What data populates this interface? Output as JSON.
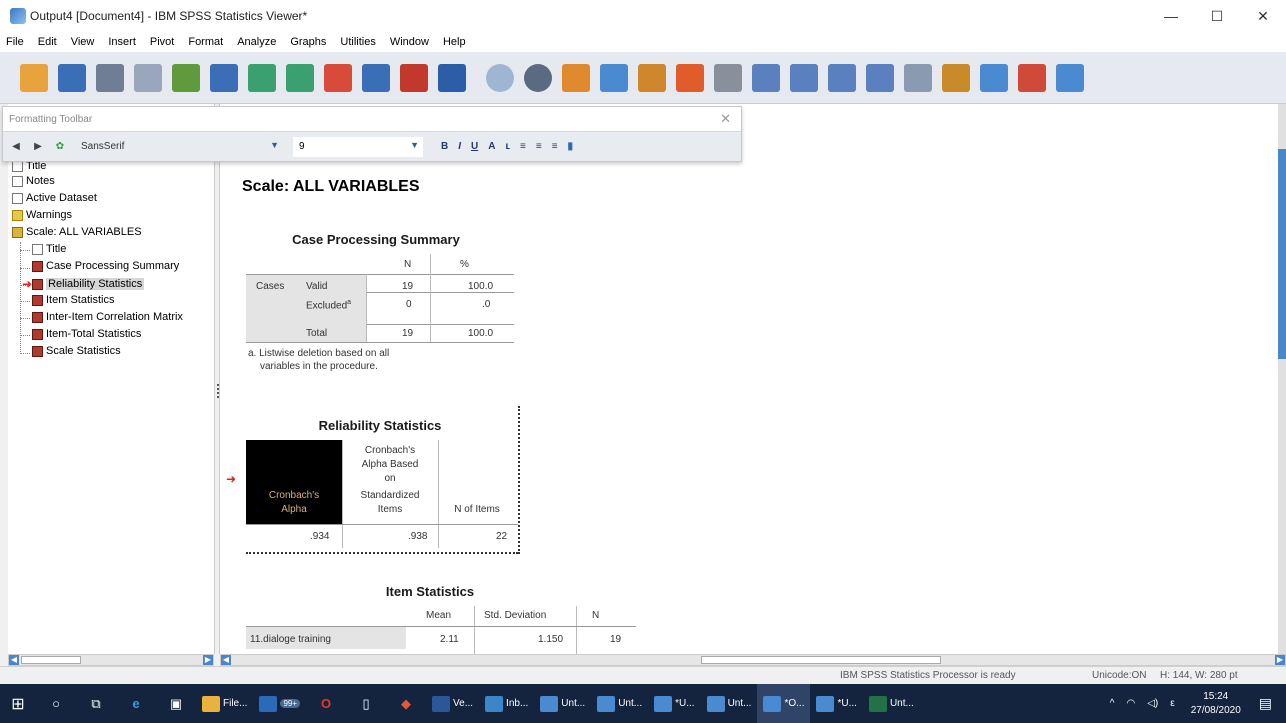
{
  "window": {
    "title": "Output4 [Document4] - IBM SPSS Statistics Viewer*",
    "min": "—",
    "max": "☐",
    "close": "✕"
  },
  "menu": [
    "File",
    "Edit",
    "View",
    "Insert",
    "Pivot",
    "Format",
    "Analyze",
    "Graphs",
    "Utilities",
    "Window",
    "Help"
  ],
  "formatting_toolbar": {
    "title": "Formatting Toolbar",
    "font": "SansSerif",
    "size": "9",
    "close": "✕",
    "bold": "B",
    "italic": "I",
    "underline": "U",
    "color": "A"
  },
  "outline": {
    "items": [
      {
        "label": "Title"
      },
      {
        "label": "Notes"
      },
      {
        "label": "Active Dataset"
      },
      {
        "label": "Warnings"
      },
      {
        "label": "Scale: ALL VARIABLES"
      },
      {
        "label": "Title"
      },
      {
        "label": "Case Processing Summary"
      },
      {
        "label": "Reliability Statistics"
      },
      {
        "label": "Item Statistics"
      },
      {
        "label": "Inter-Item Correlation Matrix"
      },
      {
        "label": "Item-Total Statistics"
      },
      {
        "label": "Scale Statistics"
      }
    ]
  },
  "content": {
    "section_title": "Scale: ALL VARIABLES",
    "case_processing": {
      "title": "Case Processing Summary",
      "col_n": "N",
      "col_pct": "%",
      "row_group": "Cases",
      "rows": [
        {
          "label": "Valid",
          "n": "19",
          "pct": "100.0"
        },
        {
          "label": "Excluded",
          "sup": "a",
          "n": "0",
          "pct": ".0"
        },
        {
          "label": "Total",
          "n": "19",
          "pct": "100.0"
        }
      ],
      "footnote_line1": "a. Listwise deletion based on all",
      "footnote_line2": "variables in the procedure."
    },
    "reliability": {
      "title": "Reliability Statistics",
      "col1_l1": "Cronbach's",
      "col1_l2": "Alpha",
      "col2_l1": "Cronbach's",
      "col2_l2": "Alpha Based",
      "col2_l3": "on",
      "col2_l4": "Standardized",
      "col2_l5": "Items",
      "col3": "N of Items",
      "v1": ".934",
      "v2": ".938",
      "v3": "22"
    },
    "item_stats": {
      "title": "Item Statistics",
      "col_mean": "Mean",
      "col_sd": "Std. Deviation",
      "col_n": "N",
      "row_label": "11.dialoge training",
      "mean": "2.11",
      "sd": "1.150",
      "n": "19"
    }
  },
  "status": {
    "processor": "IBM SPSS Statistics Processor is ready",
    "unicode": "Unicode:ON",
    "dims": "H: 144, W: 280 pt"
  },
  "taskbar": {
    "badge": "99+",
    "apps": [
      "File...",
      "Ve...",
      "Inb...",
      "Unt...",
      "Unt...",
      "*U...",
      "Unt...",
      "*O...",
      "*U...",
      "Unt..."
    ],
    "time": "15:24",
    "date": "27/08/2020",
    "lang": "ε"
  }
}
